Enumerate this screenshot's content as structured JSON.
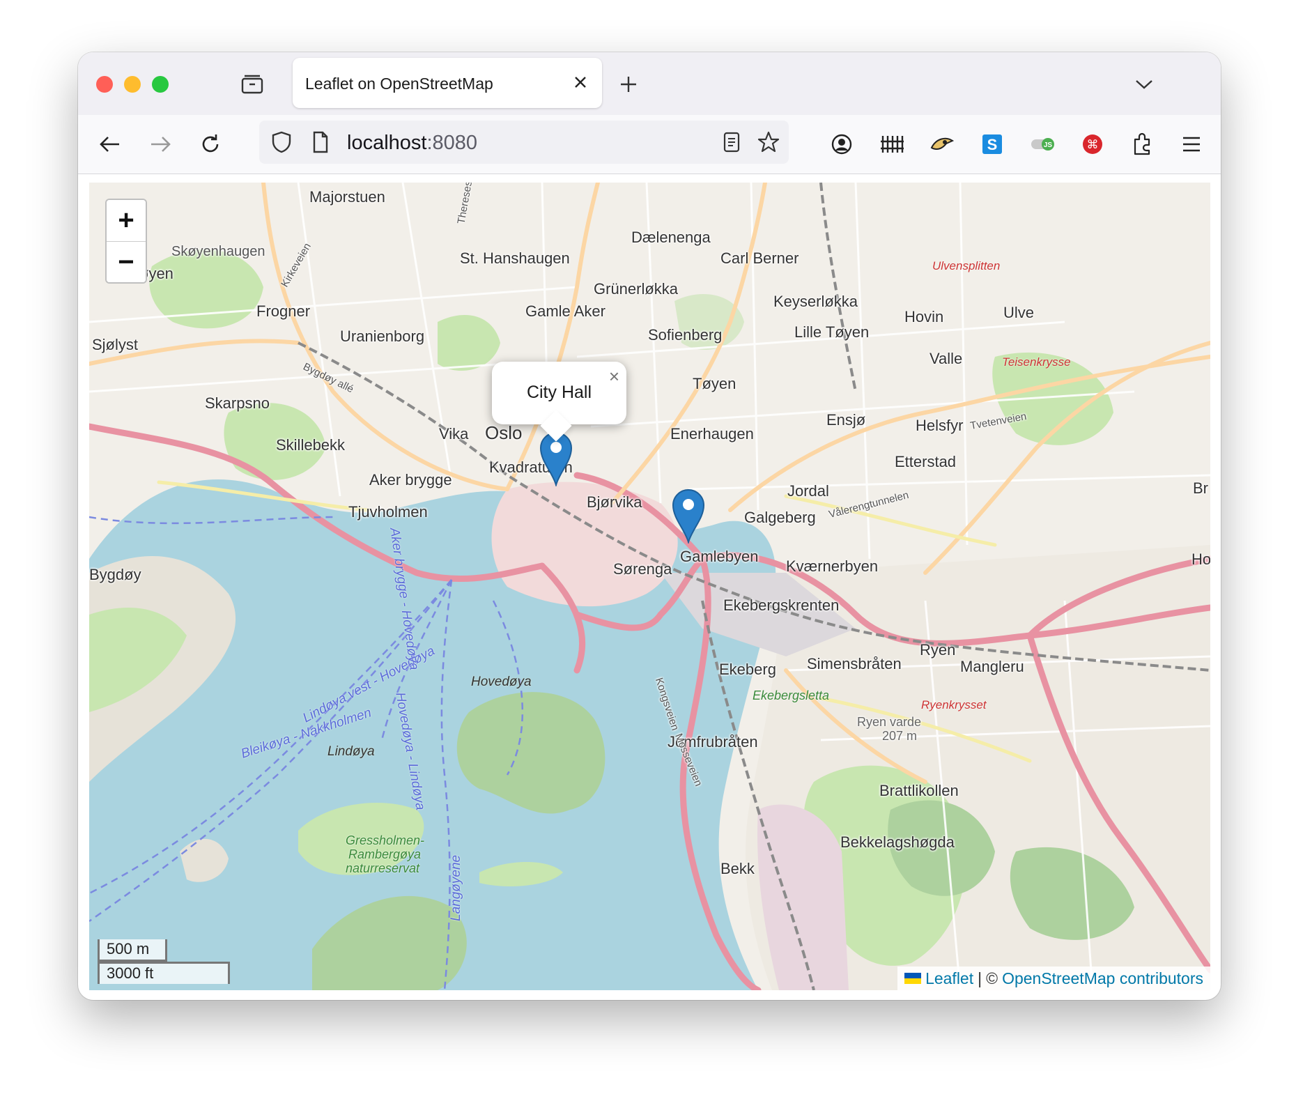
{
  "window": {
    "tab": {
      "title": "Leaflet on OpenStreetMap"
    },
    "url": {
      "host": "localhost",
      "port": ":8080"
    }
  },
  "map": {
    "popup": {
      "text": "City Hall",
      "close": "×"
    },
    "zoom": {
      "in": "+",
      "out": "−"
    },
    "scale": {
      "metric": "500 m",
      "imperial": "3000 ft"
    },
    "attribution": {
      "leaflet": "Leaflet",
      "separator": "|",
      "copyright": "©",
      "osm": "OpenStreetMap contributors"
    },
    "markers": [
      {
        "name": "City Hall"
      },
      {
        "name": "Bjørvika"
      }
    ],
    "labels": {
      "majorstuen": "Majorstuen",
      "skoyenhaugen": "Skøyenhaugen",
      "oyen": "øyen",
      "frogner": "Frogner",
      "sjolyst": "Sjølyst",
      "uranienborg": "Uranienborg",
      "st_hanshaugen": "St. Hanshaugen",
      "dalenenga": "Dælenenga",
      "carl_berner": "Carl Berner",
      "grunerlokka": "Grünerløkka",
      "gamle_aker": "Gamle Aker",
      "sofienberg": "Sofienberg",
      "keyserlokka": "Keyserløkka",
      "lille_toyen": "Lille Tøyen",
      "hovin": "Hovin",
      "valle": "Valle",
      "ulve": "Ulve",
      "skarpsno": "Skarpsno",
      "skillebekk": "Skillebekk",
      "vika": "Vika",
      "oslo": "Oslo",
      "toyen": "Tøyen",
      "enerhaugen": "Enerhaugen",
      "ensjo": "Ensjø",
      "helsfyr": "Helsfyr",
      "etterstad": "Etterstad",
      "kvadraturen": "Kvadraturen",
      "aker_brygge": "Aker brygge",
      "tjuvholmen": "Tjuvholmen",
      "bjorvika": "Bjørvika",
      "jordal": "Jordal",
      "galgeberg": "Galgeberg",
      "bygdoy": "Bygdøy",
      "sorenga": "Sørenga",
      "gamlebyen": "Gamlebyen",
      "kvaernerbyen": "Kværnerbyen",
      "ekebergskrenten": "Ekebergskrenten",
      "ekeberg": "Ekeberg",
      "simensbraten": "Simensbråten",
      "ryen": "Ryen",
      "manglerud": "Mangleru",
      "hovedoya": "Hovedøya",
      "lindoya": "Lindøya",
      "ekebergsletta": "Ekebergsletta",
      "jomfrubraten": "Jomfrubråten",
      "ryen_varde": "Ryen varde",
      "ryen_varde_elev": "207 m",
      "ryenkrysset": "Ryenkrysset",
      "brattlikollen": "Brattlikollen",
      "bekkelagshogda": "Bekkelagshøgda",
      "bekk": "Bekk",
      "gressholmen": "Gressholmen-",
      "rambergoya": "Rambergøya",
      "naturreservat": "naturreservat",
      "ulvensplitten": "Ulvensplitten",
      "teisenkrysset": "Teisenkrysse",
      "lindoya_vest": "Lindøya vest - Hovedøya",
      "bleikoya": "Bleikøya - Nakkholmen",
      "aker_brygge_hovedoya": "Aker brygge - Hovedøya",
      "langoyene": "Langøyene",
      "hovedoya_lindoya": "Hovedøya - Lindøya",
      "bygdoy_alle": "Bygdøy allé",
      "kirkeveien": "Kirkeveien",
      "thereses": "Thereses",
      "kongsveien": "Kongsveien",
      "mosseveien": "Mosseveien",
      "valerenggata": "Vålerengtunnelen",
      "br": "Br",
      "ho": "Ho",
      "tveten": "Tvetenveien"
    }
  },
  "colors": {
    "water": "#aad3df",
    "land": "#f2efe9",
    "park": "#c8e6b0",
    "forest": "#add19e",
    "motorway": "#e892a2",
    "primary": "#fcd6a4",
    "marker": "#2a81cb"
  }
}
